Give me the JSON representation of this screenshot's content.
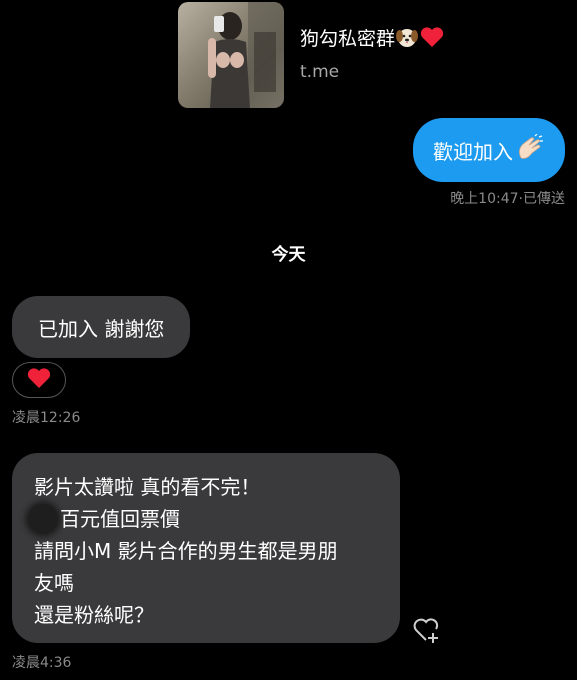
{
  "link_preview": {
    "title": "狗勾私密群",
    "url": "t.me",
    "title_emojis": [
      "dog-face-icon",
      "red-heart-icon"
    ]
  },
  "sent_message": {
    "text": "歡迎加入",
    "emoji": "clapping-hands-icon",
    "time": "晚上10:47",
    "status": "·已傳送",
    "color": "#1d9bf0"
  },
  "day_separator": "今天",
  "received_messages": [
    {
      "text": "已加入 謝謝您",
      "reaction": "red-heart-icon",
      "time": "凌晨12:26"
    },
    {
      "lines": [
        "影片太讚啦 真的看不完！",
        "百元值回票價",
        "請問小M 影片合作的男生都是男朋",
        "友嗎",
        "還是粉絲呢？"
      ],
      "time": "凌晨4:36"
    }
  ],
  "colors": {
    "background": "#000000",
    "received_bubble": "#3a3a3c",
    "meta_text": "#8a8a8a"
  }
}
